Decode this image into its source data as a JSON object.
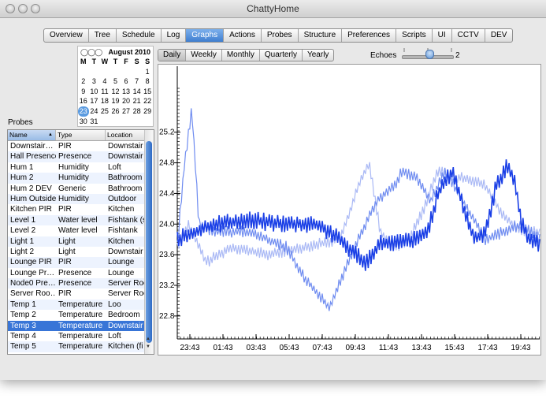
{
  "window": {
    "title": "ChattyHome"
  },
  "tabs": [
    "Overview",
    "Tree",
    "Schedule",
    "Log",
    "Graphs",
    "Actions",
    "Probes",
    "Structure",
    "Preferences",
    "Scripts",
    "UI",
    "CCTV",
    "DEV"
  ],
  "active_tab": "Graphs",
  "calendar": {
    "title": "August 2010",
    "nav": "◯◯◯",
    "day_headers": [
      "M",
      "T",
      "W",
      "T",
      "F",
      "S",
      "S"
    ],
    "weeks": [
      [
        "",
        "",
        "",
        "",
        "",
        "",
        "1"
      ],
      [
        "2",
        "3",
        "4",
        "5",
        "6",
        "7",
        "8"
      ],
      [
        "9",
        "10",
        "11",
        "12",
        "13",
        "14",
        "15"
      ],
      [
        "16",
        "17",
        "18",
        "19",
        "20",
        "21",
        "22"
      ],
      [
        "23",
        "24",
        "25",
        "26",
        "27",
        "28",
        "29"
      ],
      [
        "30",
        "31",
        "",
        "",
        "",
        "",
        ""
      ]
    ],
    "selected_day": "23"
  },
  "probes": {
    "label": "Probes",
    "columns": [
      "Name",
      "Type",
      "Location"
    ],
    "sort_indicator": "▲",
    "rows": [
      [
        "Downstair…",
        "PIR",
        "Downstair"
      ],
      [
        "Hall Presence",
        "Presence",
        "Downstair"
      ],
      [
        "Hum 1",
        "Humidity",
        "Loft"
      ],
      [
        "Hum 2",
        "Humidity",
        "Bathroom"
      ],
      [
        "Hum 2 DEV",
        "Generic",
        "Bathroom"
      ],
      [
        "Hum Outside",
        "Humidity",
        "Outdoor"
      ],
      [
        "Kitchen PIR",
        "PIR",
        "Kitchen"
      ],
      [
        "Level 1",
        "Water level",
        "Fishtank (s"
      ],
      [
        "Level 2",
        "Water level",
        "Fishtank"
      ],
      [
        "Light 1",
        "Light",
        "Kitchen"
      ],
      [
        "Light 2",
        "Light",
        "Downstair"
      ],
      [
        "Lounge PIR",
        "PIR",
        "Lounge"
      ],
      [
        "Lounge Pr…",
        "Presence",
        "Lounge"
      ],
      [
        "Node0 Pre…",
        "Presence",
        "Server Roc"
      ],
      [
        "Server Roo…",
        "PIR",
        "Server Roc"
      ],
      [
        "Temp 1",
        "Temperature",
        "Loo"
      ],
      [
        "Temp 2",
        "Temperature",
        "Bedroom"
      ],
      [
        "Temp 3",
        "Temperature",
        "Downstair"
      ],
      [
        "Temp 4",
        "Temperature",
        "Loft"
      ],
      [
        "Temp 5",
        "Temperature",
        "Kitchen (fi"
      ]
    ],
    "selected_index": 17
  },
  "period_tabs": [
    "Daily",
    "Weekly",
    "Monthly",
    "Quarterly",
    "Yearly"
  ],
  "active_period": "Daily",
  "echoes": {
    "label": "Echoes",
    "value": "2",
    "level": 0.58
  },
  "colors": {
    "primary": "#1a3fe6",
    "echo1": "#6f8cf0",
    "echo2": "#aab9f5",
    "selection": "#3875d7"
  },
  "chart_data": {
    "type": "line",
    "y_ticks": [
      "25.2",
      "24.8",
      "24.4",
      "24.0",
      "23.6",
      "23.2",
      "22.8"
    ],
    "x_ticks": [
      "23:43",
      "01:43",
      "03:43",
      "05:43",
      "07:43",
      "09:43",
      "11:43",
      "13:43",
      "15:43",
      "17:43",
      "19:43"
    ],
    "ylim": [
      22.5,
      26.0
    ],
    "series": [
      {
        "role": "current",
        "color": "#1a3fe6",
        "points": [
          [
            0,
            23.8
          ],
          [
            0.03,
            23.85
          ],
          [
            0.1,
            24.0
          ],
          [
            0.2,
            24.05
          ],
          [
            0.3,
            24.0
          ],
          [
            0.38,
            24.0
          ],
          [
            0.42,
            23.9
          ],
          [
            0.52,
            23.5
          ],
          [
            0.56,
            23.75
          ],
          [
            0.6,
            23.75
          ],
          [
            0.66,
            23.8
          ],
          [
            0.69,
            23.9
          ],
          [
            0.72,
            24.4
          ],
          [
            0.76,
            24.7
          ],
          [
            0.79,
            24.2
          ],
          [
            0.82,
            23.8
          ],
          [
            0.85,
            23.9
          ],
          [
            0.88,
            24.5
          ],
          [
            0.91,
            24.75
          ],
          [
            0.93,
            24.6
          ],
          [
            0.95,
            24.0
          ],
          [
            0.97,
            23.8
          ],
          [
            1.0,
            23.75
          ]
        ]
      },
      {
        "role": "echo",
        "color": "#6f8cf0",
        "points": [
          [
            0,
            23.7
          ],
          [
            0.02,
            24.8
          ],
          [
            0.04,
            25.5
          ],
          [
            0.06,
            24.0
          ],
          [
            0.1,
            23.9
          ],
          [
            0.2,
            23.9
          ],
          [
            0.3,
            23.7
          ],
          [
            0.35,
            23.3
          ],
          [
            0.42,
            22.9
          ],
          [
            0.48,
            23.6
          ],
          [
            0.55,
            24.3
          ],
          [
            0.6,
            24.5
          ],
          [
            0.62,
            24.7
          ],
          [
            0.66,
            24.6
          ],
          [
            0.7,
            24.3
          ],
          [
            0.74,
            24.7
          ],
          [
            0.8,
            24.2
          ],
          [
            0.85,
            23.8
          ],
          [
            0.9,
            23.9
          ],
          [
            0.95,
            24.0
          ],
          [
            1.0,
            23.8
          ]
        ]
      },
      {
        "role": "echo",
        "color": "#aab9f5",
        "points": [
          [
            0,
            23.7
          ],
          [
            0.03,
            24.0
          ],
          [
            0.08,
            23.5
          ],
          [
            0.15,
            23.7
          ],
          [
            0.25,
            23.6
          ],
          [
            0.35,
            23.7
          ],
          [
            0.45,
            23.8
          ],
          [
            0.5,
            24.5
          ],
          [
            0.53,
            24.8
          ],
          [
            0.56,
            23.9
          ],
          [
            0.6,
            23.7
          ],
          [
            0.64,
            23.8
          ],
          [
            0.68,
            24.2
          ],
          [
            0.72,
            24.7
          ],
          [
            0.76,
            24.6
          ],
          [
            0.8,
            24.6
          ],
          [
            0.85,
            24.5
          ],
          [
            0.9,
            24.1
          ],
          [
            0.95,
            23.9
          ],
          [
            1.0,
            23.9
          ]
        ]
      }
    ]
  }
}
